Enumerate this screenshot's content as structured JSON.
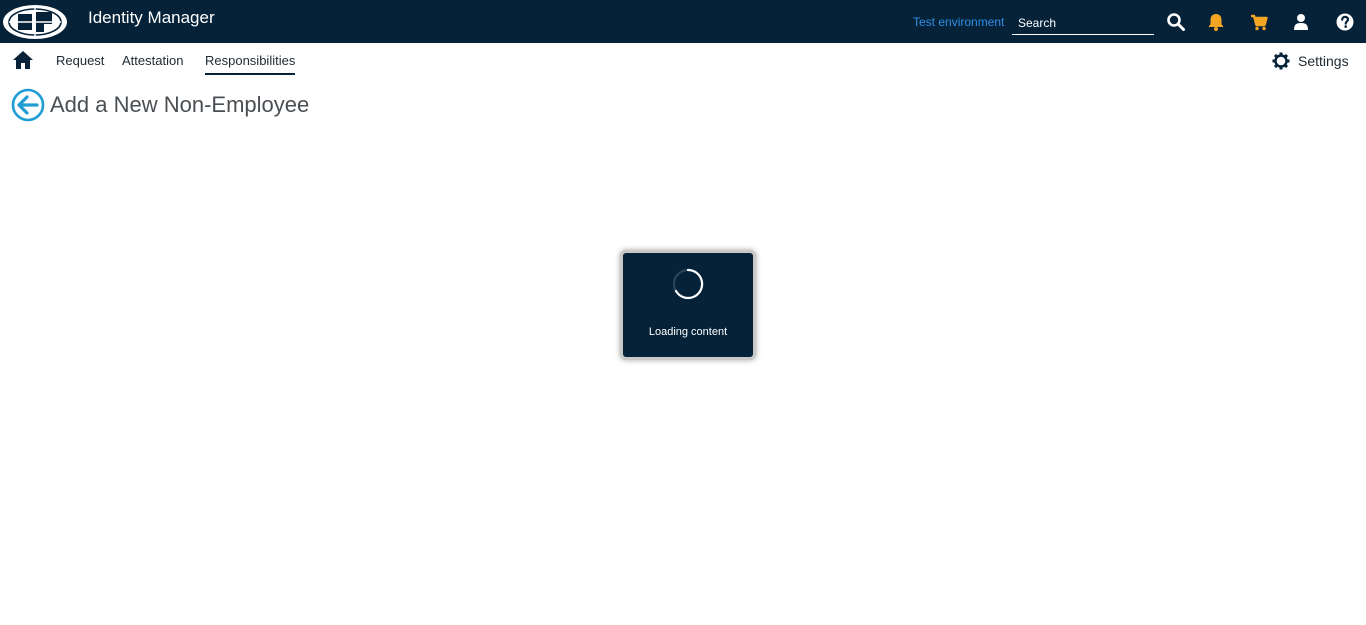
{
  "header": {
    "app_title": "Identity Manager",
    "environment": "Test environment",
    "search": {
      "placeholder": "Search",
      "value": ""
    },
    "icons": [
      "search-icon",
      "bell-icon",
      "cart-icon",
      "user-icon",
      "help-icon"
    ],
    "colors": {
      "background": "#052238",
      "environment": "#2f8fe6",
      "alert_icons": "#f5a623"
    }
  },
  "nav": {
    "items": [
      {
        "label": "Request",
        "active": false
      },
      {
        "label": "Attestation",
        "active": false
      },
      {
        "label": "Responsibilities",
        "active": true
      }
    ],
    "settings_label": "Settings"
  },
  "page": {
    "title": "Add a New Non-Employee",
    "back_icon_color": "#1f9ed6"
  },
  "loading": {
    "text": "Loading content"
  }
}
